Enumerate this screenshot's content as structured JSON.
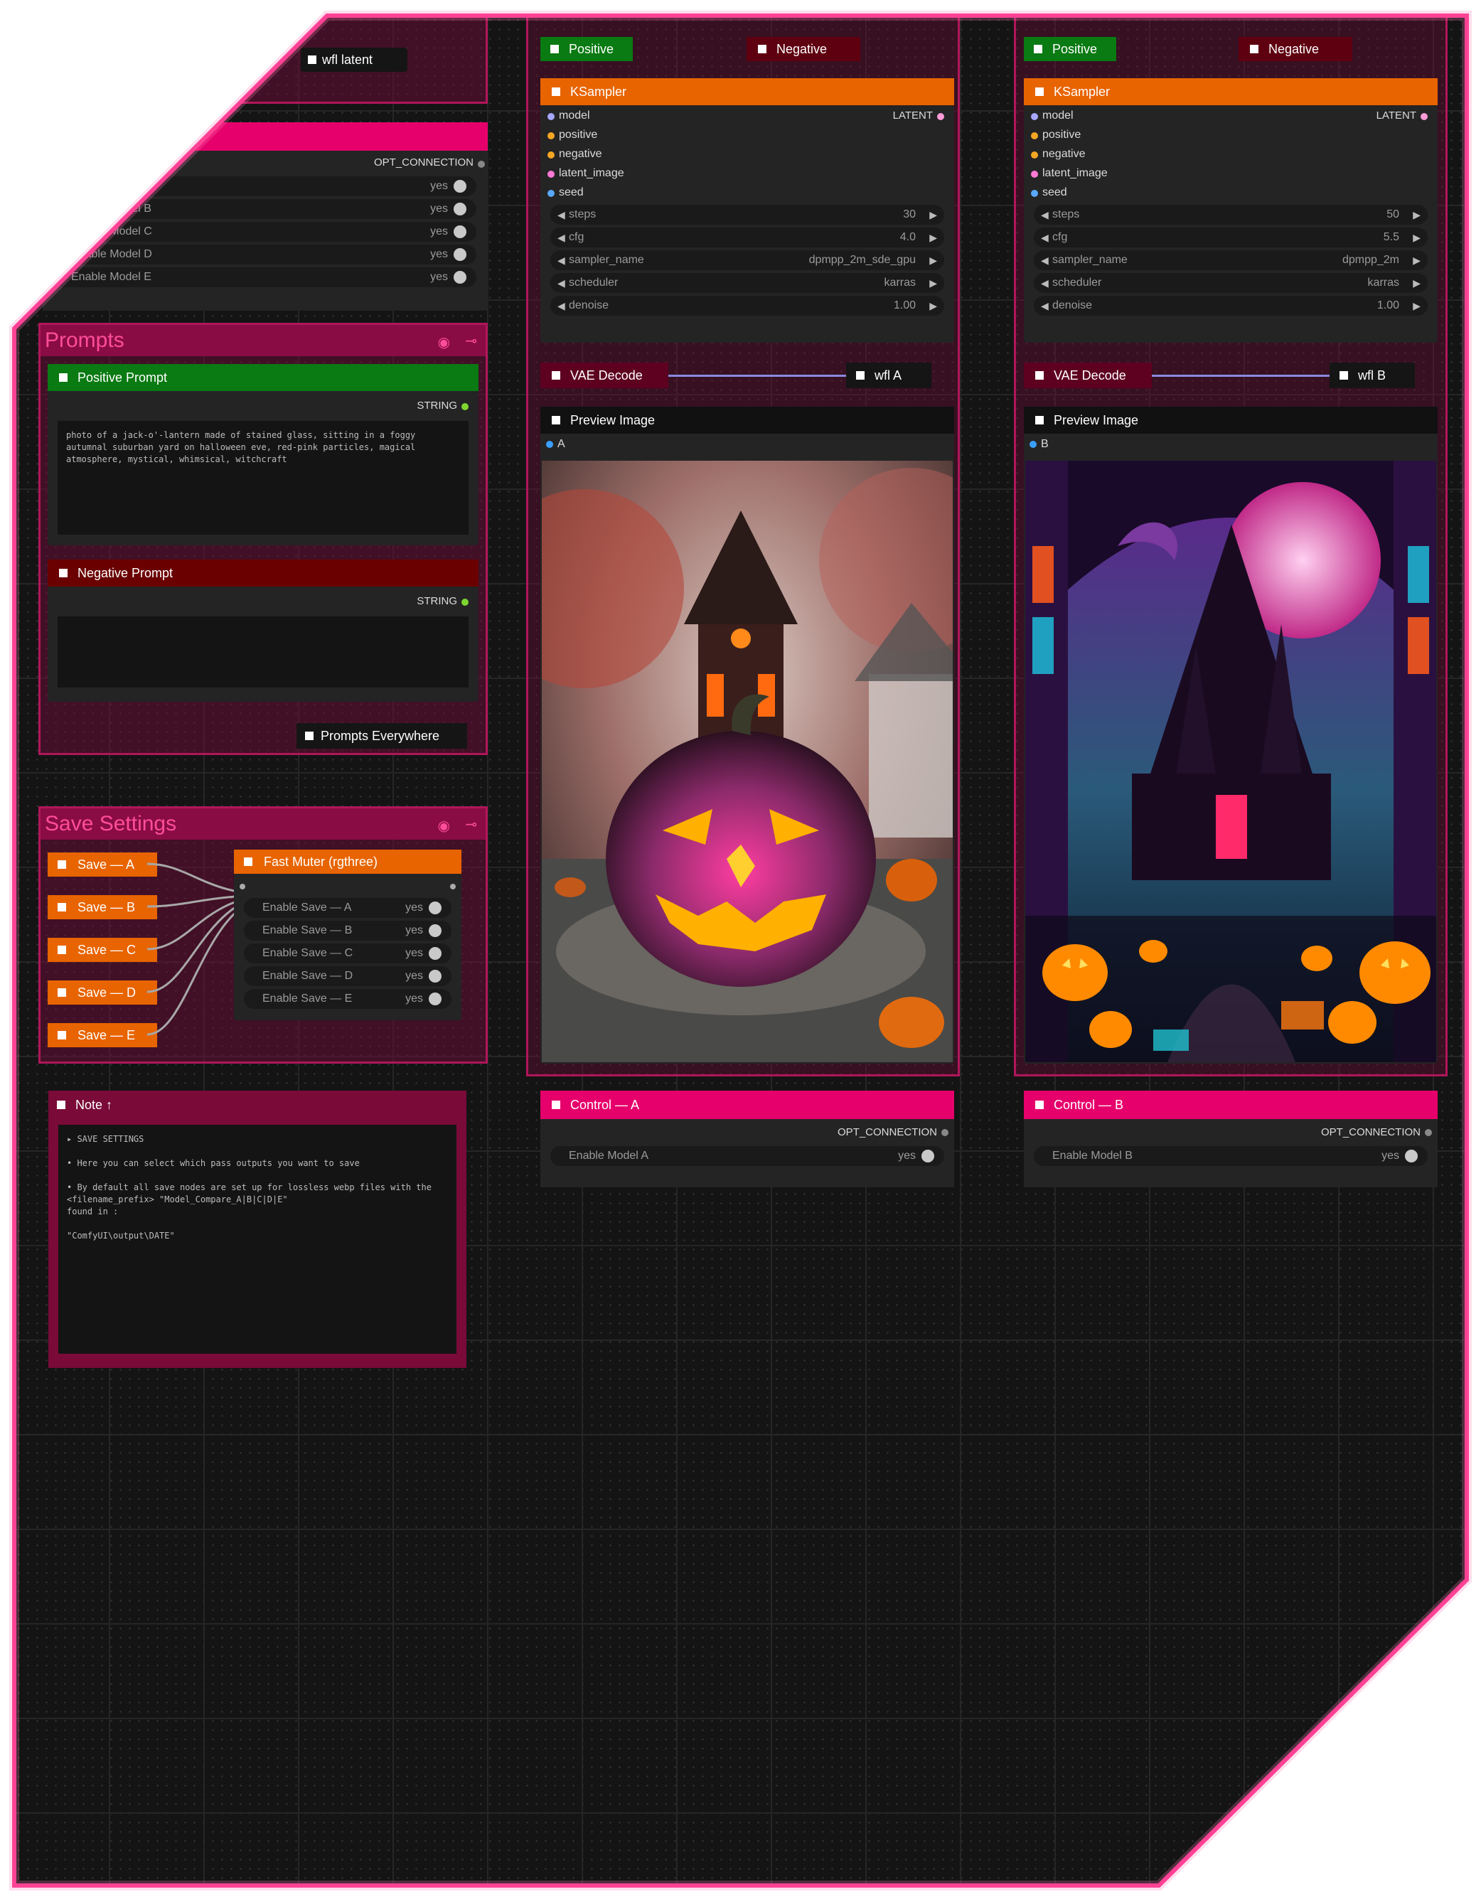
{
  "top_left": {
    "latent_label": "wfl latent"
  },
  "control_group_widgets": [
    {
      "label": "",
      "value": "yes"
    },
    {
      "label": "Enable Model B",
      "value": "yes"
    },
    {
      "label": "Enable Model C",
      "value": "yes"
    },
    {
      "label": "Enable Model D",
      "value": "yes"
    },
    {
      "label": "Enable Model E",
      "value": "yes"
    }
  ],
  "control_group": {
    "output_label": "OPT_CONNECTION"
  },
  "prompts_group": {
    "title": "Prompts",
    "positive": {
      "title": "Positive Prompt",
      "output": "STRING",
      "text": "photo of a jack-o'-lantern made of stained glass, sitting in a foggy autumnal suburban yard on halloween eve, red-pink particles, magical atmosphere, mystical, whimsical, witchcraft"
    },
    "negative": {
      "title": "Negative Prompt",
      "output": "STRING",
      "text": ""
    },
    "everywhere": "Prompts Everywhere"
  },
  "save_group": {
    "title": "Save Settings",
    "save_buttons": [
      "Save — A",
      "Save — B",
      "Save — C",
      "Save — D",
      "Save — E"
    ],
    "muter_title": "Fast Muter (rgthree)",
    "muter_widgets": [
      {
        "label": "Enable Save — A",
        "value": "yes"
      },
      {
        "label": "Enable Save — B",
        "value": "yes"
      },
      {
        "label": "Enable Save — C",
        "value": "yes"
      },
      {
        "label": "Enable Save — D",
        "value": "yes"
      },
      {
        "label": "Enable Save — E",
        "value": "yes"
      }
    ]
  },
  "note": {
    "title": "Note ↑",
    "lines": [
      "▸ SAVE SETTINGS",
      "",
      "• Here you can select which pass outputs you want to save",
      "",
      "• By default all save nodes are set up for lossless webp files with the",
      "<filename_prefix> \"Model_Compare_A|B|C|D|E\"",
      "found in :",
      "",
      "\"ComfyUI\\output\\DATE\""
    ]
  },
  "column_a": {
    "positive": "Positive",
    "negative": "Negative",
    "ksampler": {
      "title": "KSampler",
      "inputs": [
        "model",
        "positive",
        "negative",
        "latent_image",
        "seed"
      ],
      "output": "LATENT",
      "widgets": [
        {
          "label": "steps",
          "value": "30"
        },
        {
          "label": "cfg",
          "value": "4.0"
        },
        {
          "label": "sampler_name",
          "value": "dpmpp_2m_sde_gpu"
        },
        {
          "label": "scheduler",
          "value": "karras"
        },
        {
          "label": "denoise",
          "value": "1.00"
        }
      ]
    },
    "vae": "VAE Decode",
    "wfl": "wfl A",
    "preview": "Preview Image",
    "preview_input": "A",
    "control": {
      "title": "Control — A",
      "output": "OPT_CONNECTION",
      "widget": "Enable Model A",
      "value": "yes"
    }
  },
  "column_b": {
    "positive": "Positive",
    "negative": "Negative",
    "ksampler": {
      "title": "KSampler",
      "inputs": [
        "model",
        "positive",
        "negative",
        "latent_image",
        "seed"
      ],
      "output": "LATENT",
      "widgets": [
        {
          "label": "steps",
          "value": "50"
        },
        {
          "label": "cfg",
          "value": "5.5"
        },
        {
          "label": "sampler_name",
          "value": "dpmpp_2m"
        },
        {
          "label": "scheduler",
          "value": "karras"
        },
        {
          "label": "denoise",
          "value": "1.00"
        }
      ]
    },
    "vae": "VAE Decode",
    "wfl": "wfl B",
    "preview": "Preview Image",
    "preview_input": "B",
    "control": {
      "title": "Control — B",
      "output": "OPT_CONNECTION",
      "widget": "Enable Model B",
      "value": "yes"
    }
  },
  "colors": {
    "accent_pink": "#e6006b",
    "ksampler_orange": "#e86400",
    "positive_green": "#0a7a12",
    "negative_maroon": "#6b0000",
    "frame_glow": "#ff2f8a"
  }
}
